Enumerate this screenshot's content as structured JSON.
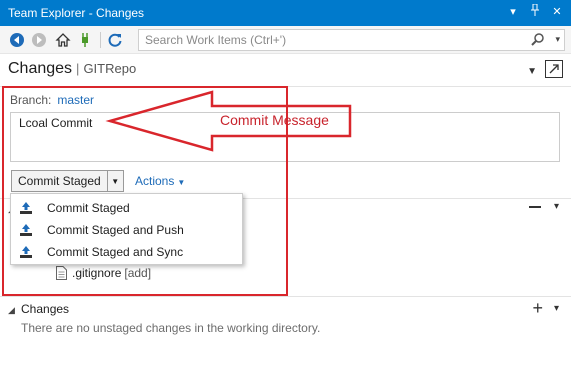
{
  "window": {
    "title": "Team Explorer - Changes"
  },
  "titlebar": {
    "icons": [
      "dropdown-icon",
      "pin-icon",
      "close-icon"
    ]
  },
  "toolbar": {
    "buttons": [
      "back-icon",
      "forward-icon",
      "home-icon",
      "connect-icon",
      "refresh-icon"
    ],
    "search_placeholder": "Search Work Items (Ctrl+')"
  },
  "header": {
    "title": "Changes",
    "separator": "|",
    "repo": "GITRepo"
  },
  "branch": {
    "label": "Branch:",
    "value": "master"
  },
  "commit_message": {
    "value": "Lcoal Commit"
  },
  "commit_button": {
    "label": "Commit Staged"
  },
  "actions": {
    "label": "Actions"
  },
  "dropdown": {
    "items": [
      {
        "label": "Commit Staged"
      },
      {
        "label": "Commit Staged and Push"
      },
      {
        "label": "Commit Staged and Sync"
      }
    ]
  },
  "staged_files": [
    {
      "name": ".gitignore",
      "status": "[add]"
    }
  ],
  "changes": {
    "title": "Changes",
    "empty_text": "There are no unstaged changes in the working directory."
  },
  "annotation": {
    "label": "Commit Message",
    "color": "#d9262c"
  },
  "colors": {
    "accent": "#007acc",
    "link": "#1e6bb8"
  }
}
